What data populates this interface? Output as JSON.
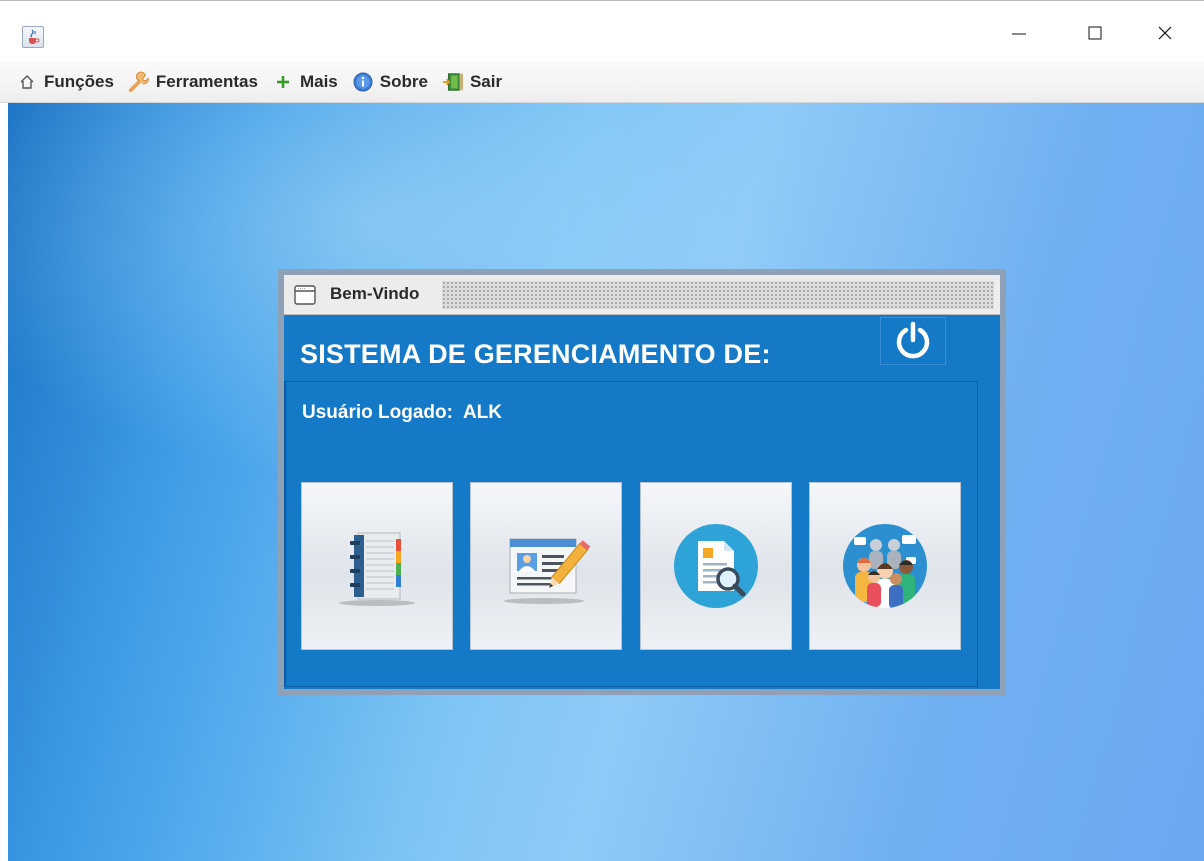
{
  "window": {
    "icon": "java-cup-icon",
    "controls": [
      "minimize-icon",
      "maximize-icon",
      "close-icon"
    ]
  },
  "menubar": {
    "items": [
      {
        "label": "Funções",
        "icon": "home-icon"
      },
      {
        "label": "Ferramentas",
        "icon": "wrench-icon"
      },
      {
        "label": "Mais",
        "icon": "plus-icon"
      },
      {
        "label": "Sobre",
        "icon": "info-icon"
      },
      {
        "label": "Sair",
        "icon": "exit-door-icon"
      }
    ]
  },
  "internal_frame": {
    "title": "Bem-Vindo",
    "icon": "frame-window-icon",
    "system_title": "SISTEMA DE GERENCIAMENTO DE:",
    "power_icon": "power-icon",
    "user_label": "Usuário Logado:",
    "user_value": "ALK",
    "tiles": [
      {
        "icon": "address-book-icon"
      },
      {
        "icon": "id-card-edit-icon"
      },
      {
        "icon": "document-search-icon"
      },
      {
        "icon": "people-group-icon"
      }
    ]
  },
  "colors": {
    "panel_blue": "#1479c7",
    "frame_border": "#8ea1b6",
    "menu_text": "#2b2b2b",
    "plus_green": "#3a9a2a"
  }
}
